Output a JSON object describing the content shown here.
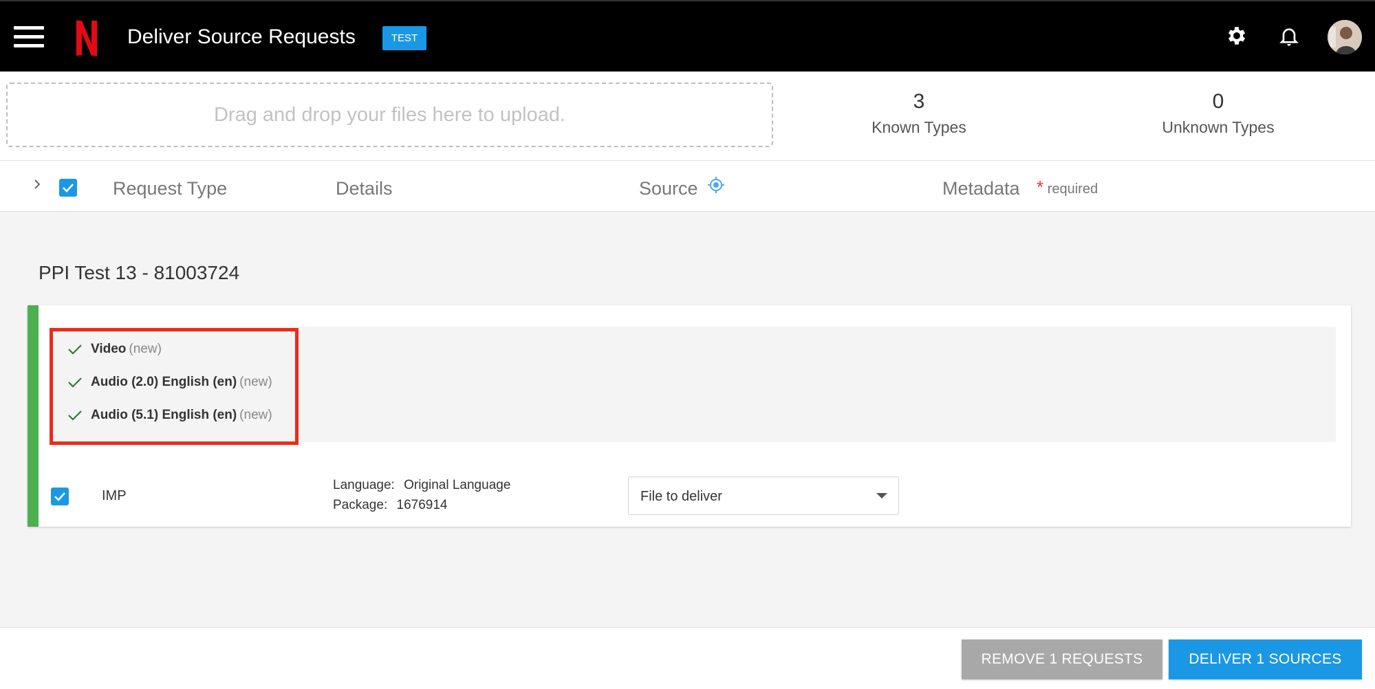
{
  "header": {
    "title": "Deliver Source Requests",
    "env_badge": "TEST",
    "logo_letter": "N"
  },
  "upload": {
    "dropzone_text": "Drag and drop your files here to upload.",
    "known_count": "3",
    "known_label": "Known Types",
    "unknown_count": "0",
    "unknown_label": "Unknown Types"
  },
  "columns": {
    "request_type": "Request Type",
    "details": "Details",
    "source": "Source",
    "metadata": "Metadata",
    "required_star": "*",
    "required_label": "required"
  },
  "group": {
    "title": "PPI Test 13 - 81003724",
    "tracks": [
      {
        "label": "Video",
        "tag": "(new)"
      },
      {
        "label": "Audio (2.0) English (en)",
        "tag": "(new)"
      },
      {
        "label": "Audio (5.1) English (en)",
        "tag": "(new)"
      }
    ],
    "request": {
      "type": "IMP",
      "language_key": "Language:",
      "language_value": "Original Language",
      "package_key": "Package:",
      "package_value": "1676914",
      "source_select": "File to deliver"
    }
  },
  "footer": {
    "remove_label": "REMOVE 1 REQUESTS",
    "deliver_label": "DELIVER 1 SOURCES"
  },
  "colors": {
    "accent": "#1a98e6",
    "success": "#4caf50",
    "highlight": "#ee2a1b",
    "brand": "#e50914"
  },
  "icons": [
    "menu-icon",
    "netflix-logo",
    "gear-icon",
    "bell-icon",
    "avatar",
    "chevron-right-icon",
    "checkbox-checked-icon",
    "crosshair-icon",
    "check-icon",
    "chevron-down-icon"
  ]
}
